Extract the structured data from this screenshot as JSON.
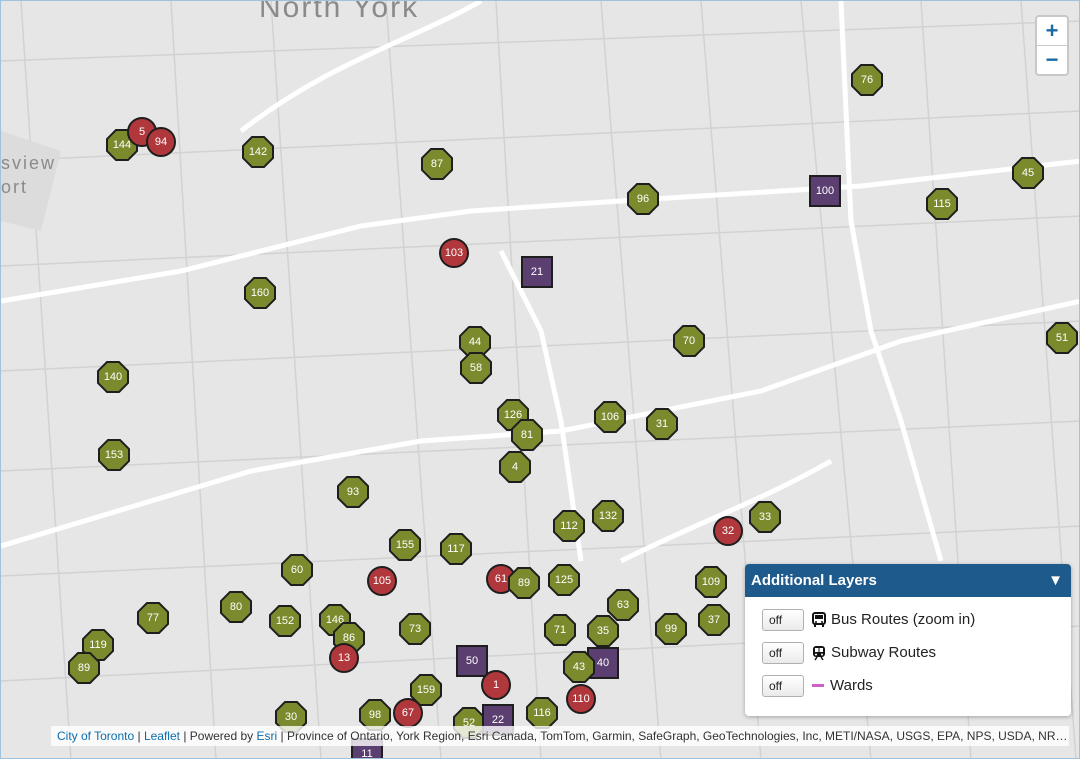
{
  "map": {
    "place_labels": [
      "North York",
      "sview",
      "ort"
    ],
    "attribution": {
      "city_link": "City of Toronto",
      "sep1": " | ",
      "leaflet_link": "Leaflet",
      "powered_by": " | Powered by ",
      "esri_link": "Esri",
      "sources": " | Province of Ontario, York Region, Esri Canada, TomTom, Garmin, SafeGraph, GeoTechnologies, Inc, METI/NASA, USGS, EPA, NPS, USDA, NR…"
    },
    "zoom_in_label": "+",
    "zoom_out_label": "−",
    "colors": {
      "green_marker": "#7a8a2c",
      "red_marker": "#b0373b",
      "purple_marker": "#5a3f70",
      "panel_header": "#1f5a8c",
      "link": "#0b6eaa",
      "wards_line": "#d060c8"
    }
  },
  "layers_panel": {
    "title": "Additional Layers",
    "collapse_icon": "▼",
    "layers": [
      {
        "toggle": "off",
        "icon": "bus-icon",
        "label": "Bus Routes (zoom in)"
      },
      {
        "toggle": "off",
        "icon": "subway-icon",
        "label": "Subway Routes"
      },
      {
        "toggle": "off",
        "icon": "line-swatch-icon",
        "label": "Wards"
      }
    ]
  },
  "markers": [
    {
      "label": "76",
      "kind": "green"
    },
    {
      "label": "45",
      "kind": "green"
    },
    {
      "label": "115",
      "kind": "green"
    },
    {
      "label": "100",
      "kind": "purple"
    },
    {
      "label": "96",
      "kind": "green"
    },
    {
      "label": "142",
      "kind": "green"
    },
    {
      "label": "87",
      "kind": "green"
    },
    {
      "label": "144",
      "kind": "green"
    },
    {
      "label": "5",
      "kind": "red"
    },
    {
      "label": "94",
      "kind": "red"
    },
    {
      "label": "103",
      "kind": "red"
    },
    {
      "label": "21",
      "kind": "purple"
    },
    {
      "label": "160",
      "kind": "green"
    },
    {
      "label": "44",
      "kind": "green"
    },
    {
      "label": "58",
      "kind": "green"
    },
    {
      "label": "70",
      "kind": "green"
    },
    {
      "label": "51",
      "kind": "green"
    },
    {
      "label": "140",
      "kind": "green"
    },
    {
      "label": "126",
      "kind": "green"
    },
    {
      "label": "81",
      "kind": "green"
    },
    {
      "label": "106",
      "kind": "green"
    },
    {
      "label": "31",
      "kind": "green"
    },
    {
      "label": "4",
      "kind": "green"
    },
    {
      "label": "153",
      "kind": "green"
    },
    {
      "label": "93",
      "kind": "green"
    },
    {
      "label": "112",
      "kind": "green"
    },
    {
      "label": "132",
      "kind": "green"
    },
    {
      "label": "32",
      "kind": "red"
    },
    {
      "label": "33",
      "kind": "green"
    },
    {
      "label": "155",
      "kind": "green"
    },
    {
      "label": "117",
      "kind": "green"
    },
    {
      "label": "60",
      "kind": "green"
    },
    {
      "label": "105",
      "kind": "red"
    },
    {
      "label": "61",
      "kind": "red"
    },
    {
      "label": "89",
      "kind": "green"
    },
    {
      "label": "125",
      "kind": "green"
    },
    {
      "label": "109",
      "kind": "green"
    },
    {
      "label": "80",
      "kind": "green"
    },
    {
      "label": "77",
      "kind": "green"
    },
    {
      "label": "152",
      "kind": "green"
    },
    {
      "label": "146",
      "kind": "green"
    },
    {
      "label": "86",
      "kind": "green"
    },
    {
      "label": "73",
      "kind": "green"
    },
    {
      "label": "63",
      "kind": "green"
    },
    {
      "label": "71",
      "kind": "green"
    },
    {
      "label": "35",
      "kind": "green"
    },
    {
      "label": "99",
      "kind": "green"
    },
    {
      "label": "37",
      "kind": "green"
    },
    {
      "label": "119",
      "kind": "green"
    },
    {
      "label": "13",
      "kind": "red"
    },
    {
      "label": "50",
      "kind": "purple"
    },
    {
      "label": "40",
      "kind": "purple"
    },
    {
      "label": "43",
      "kind": "green"
    },
    {
      "label": "89",
      "kind": "green"
    },
    {
      "label": "159",
      "kind": "green"
    },
    {
      "label": "1",
      "kind": "red"
    },
    {
      "label": "30",
      "kind": "green"
    },
    {
      "label": "98",
      "kind": "green"
    },
    {
      "label": "67",
      "kind": "red"
    },
    {
      "label": "52",
      "kind": "green"
    },
    {
      "label": "22",
      "kind": "purple"
    },
    {
      "label": "116",
      "kind": "green"
    },
    {
      "label": "110",
      "kind": "red"
    },
    {
      "label": "11",
      "kind": "purple"
    }
  ]
}
